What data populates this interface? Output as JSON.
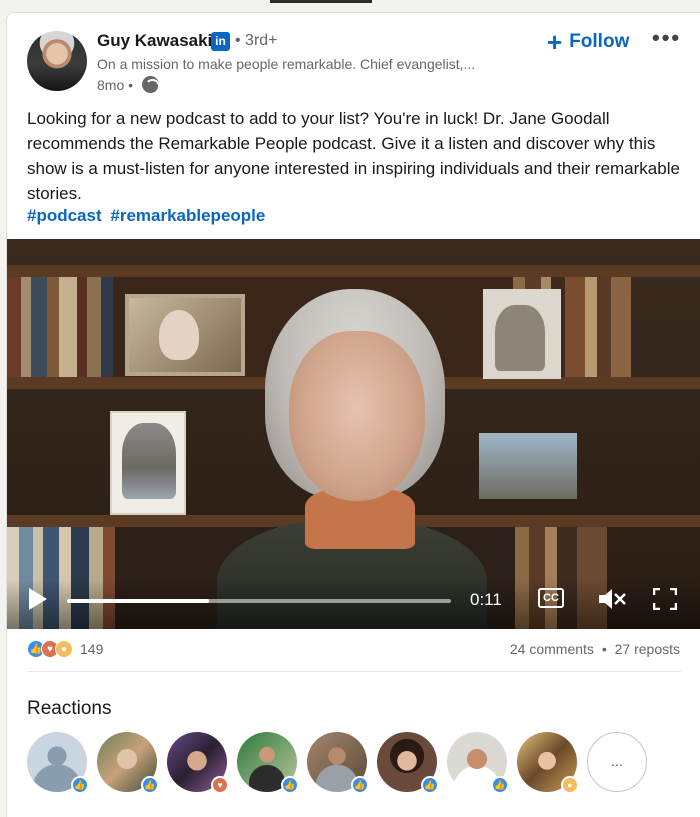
{
  "post": {
    "author_name": "Guy Kawasaki",
    "linkedin_badge": "in",
    "connection_degree": "• 3rd+",
    "headline": "On a mission to make people remarkable. Chief evangelist,...",
    "time_ago": "8mo •",
    "follow_label": "Follow",
    "follow_plus": "+",
    "more_label": "•••",
    "text": "Looking for a new podcast to add to your list? You're in luck! Dr. Jane Goodall recommends the Remarkable People podcast. Give it a listen and discover why this show is a must-listen for anyone interested in inspiring individuals and their remarkable stories.",
    "hashtags": [
      "#podcast",
      "#remarkablepeople"
    ]
  },
  "video": {
    "time": "0:11",
    "progress_fraction": 0.37,
    "cc_label": "CC",
    "muted": true
  },
  "social": {
    "reaction_count": "149",
    "comments": "24 comments",
    "separator": "•",
    "reposts": "27 reposts"
  },
  "reactions": {
    "title": "Reactions",
    "more_label": "..."
  },
  "colors": {
    "accent": "#0a66c2",
    "like": "#378fe9",
    "love": "#df704d",
    "insight": "#f5bb5c"
  }
}
